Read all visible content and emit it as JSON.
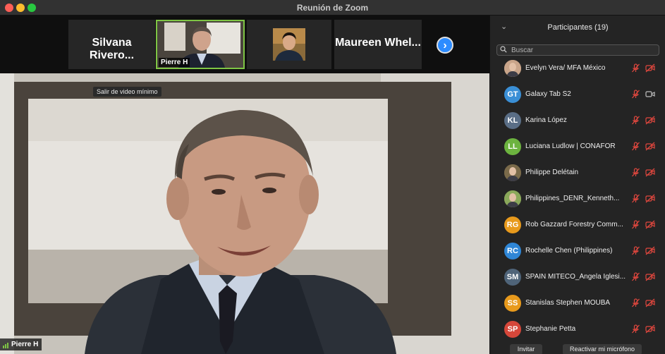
{
  "window": {
    "title": "Reunión de Zoom"
  },
  "thumbnails": [
    {
      "name": "Silvana Rivero...",
      "type": "name"
    },
    {
      "name": "Pierre H",
      "type": "video"
    },
    {
      "name": "",
      "type": "video"
    },
    {
      "name": "Maureen Whel...",
      "type": "name"
    }
  ],
  "main": {
    "tooltip": "Salir de video mínimo",
    "speaker": "Pierre H"
  },
  "panel": {
    "title": "Participantes (19)",
    "search_placeholder": "Buscar",
    "participants": [
      {
        "initials": "",
        "name": "Evelyn Vera/ MFA México",
        "color": "#c9a58a",
        "photo": true,
        "mic": "muted",
        "cam": "off"
      },
      {
        "initials": "GT",
        "name": "Galaxy Tab S2",
        "color": "#3a8fd6",
        "photo": false,
        "mic": "muted",
        "cam": "on"
      },
      {
        "initials": "KL",
        "name": "Karina López",
        "color": "#5a6e86",
        "photo": false,
        "mic": "muted",
        "cam": "off"
      },
      {
        "initials": "LL",
        "name": "Luciana Ludlow | CONAFOR",
        "color": "#6cb33f",
        "photo": false,
        "mic": "muted",
        "cam": "off"
      },
      {
        "initials": "",
        "name": "Philippe Delétain",
        "color": "#7a6a4a",
        "photo": true,
        "mic": "muted",
        "cam": "off"
      },
      {
        "initials": "",
        "name": "Philippines_DENR_Kenneth...",
        "color": "#8aa85a",
        "photo": true,
        "mic": "muted",
        "cam": "off"
      },
      {
        "initials": "RG",
        "name": "Rob Gazzard Forestry Comm...",
        "color": "#e89a1c",
        "photo": false,
        "mic": "muted",
        "cam": "off"
      },
      {
        "initials": "RC",
        "name": "Rochelle Chen (Philippines)",
        "color": "#2f86d6",
        "photo": false,
        "mic": "muted",
        "cam": "off"
      },
      {
        "initials": "SM",
        "name": "SPAIN MITECO_Ángela Iglesi...",
        "color": "#4f6479",
        "photo": false,
        "mic": "muted",
        "cam": "off"
      },
      {
        "initials": "SS",
        "name": "Stanislas Stephen MOUBA",
        "color": "#e89a1c",
        "photo": false,
        "mic": "muted",
        "cam": "off"
      },
      {
        "initials": "SP",
        "name": "Stephanie Petta",
        "color": "#d6473a",
        "photo": false,
        "mic": "muted",
        "cam": "off"
      }
    ],
    "invite_label": "Invitar",
    "unmute_label": "Reactivar mi micrófono"
  },
  "colors": {
    "accent": "#2d8cff",
    "active_speaker": "#7ec544",
    "muted": "#e0473e"
  }
}
